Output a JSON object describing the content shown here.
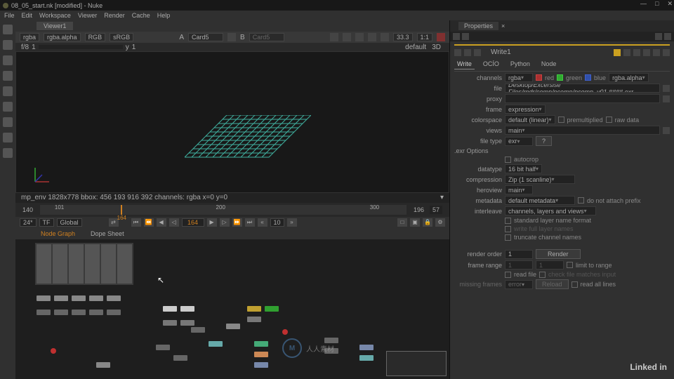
{
  "title": "08_05_start.nk [modified] - Nuke",
  "menus": [
    "File",
    "Edit",
    "Workspace",
    "Viewer",
    "Render",
    "Cache",
    "Help"
  ],
  "winbtns": [
    "—",
    "□",
    "✕"
  ],
  "viewer_tab": "Viewer1",
  "vtb": {
    "layer": "rgba",
    "alpha": "rgba.alpha",
    "ch": "RGB",
    "cs": "sRGB",
    "a_lbl": "A",
    "a_val": "Card5",
    "b_lbl": "B",
    "b_val": "Card5",
    "zoom": "33.3",
    "aspect": "1:1"
  },
  "ruler": {
    "f": "f/8",
    "one": "1",
    "y": "y",
    "one2": "1",
    "mode": "3D",
    "def": "default"
  },
  "status": "mp_env 1828x778   bbox: 456 193 916 392 channels: rgba     x=0 y=0",
  "timeline": {
    "start": "140",
    "t101": "101",
    "cur": "164",
    "t200": "200",
    "t300": "300",
    "end": "196",
    "fps": "57"
  },
  "play": {
    "fps_sel": "24*",
    "tf": "TF",
    "scope": "Global",
    "cur": "164",
    "inc": "10"
  },
  "ntabs": {
    "ng": "Node Graph",
    "ds": "Dope Sheet"
  },
  "props_tab": "Properties",
  "node_name": "Write1",
  "subtabs": [
    "Write",
    "OCÍO",
    "Python",
    "Node"
  ],
  "rows": {
    "channels_lbl": "channels",
    "channels": "rgba",
    "red": "red",
    "green": "green",
    "blue": "blue",
    "alpha": "rgba.alpha",
    "file_lbl": "file",
    "file": "Desktop/Excersise Files/rndr/comp/pcomp/pcomp_v01.####.exr",
    "proxy_lbl": "proxy",
    "frame_lbl": "frame",
    "frame": "expression",
    "colorspace_lbl": "colorspace",
    "colorspace": "default (linear)",
    "premult": "premultiplied",
    "raw": "raw data",
    "views_lbl": "views",
    "views": "main",
    "filetype_lbl": "file type",
    "filetype": "exr",
    "q": "?",
    "exropt": ".exr Options",
    "autocrop": "autocrop",
    "datatype_lbl": "datatype",
    "datatype": "16 bit half",
    "compression_lbl": "compression",
    "compression": "Zip (1 scanline)",
    "heroview_lbl": "heroview",
    "heroview": "main",
    "metadata_lbl": "metadata",
    "metadata": "default metadata",
    "noprefix": "do not attach prefix",
    "interleave_lbl": "interleave",
    "interleave": "channels, layers and views",
    "std_layer": "standard layer name format",
    "write_full": "write full layer names",
    "truncate": "truncate channel names",
    "rorder_lbl": "render order",
    "rorder": "1",
    "render_btn": "Render",
    "frange_lbl": "frame range",
    "fr1": "1",
    "fr2": "1",
    "limit": "limit to range",
    "readfile": "read file",
    "checkfile": "check file matches input",
    "missing_lbl": "missing frames",
    "missing": "error",
    "reload": "Reload",
    "readall": "read all lines"
  },
  "watermark": "人人素材",
  "linkedin": "Linked in"
}
